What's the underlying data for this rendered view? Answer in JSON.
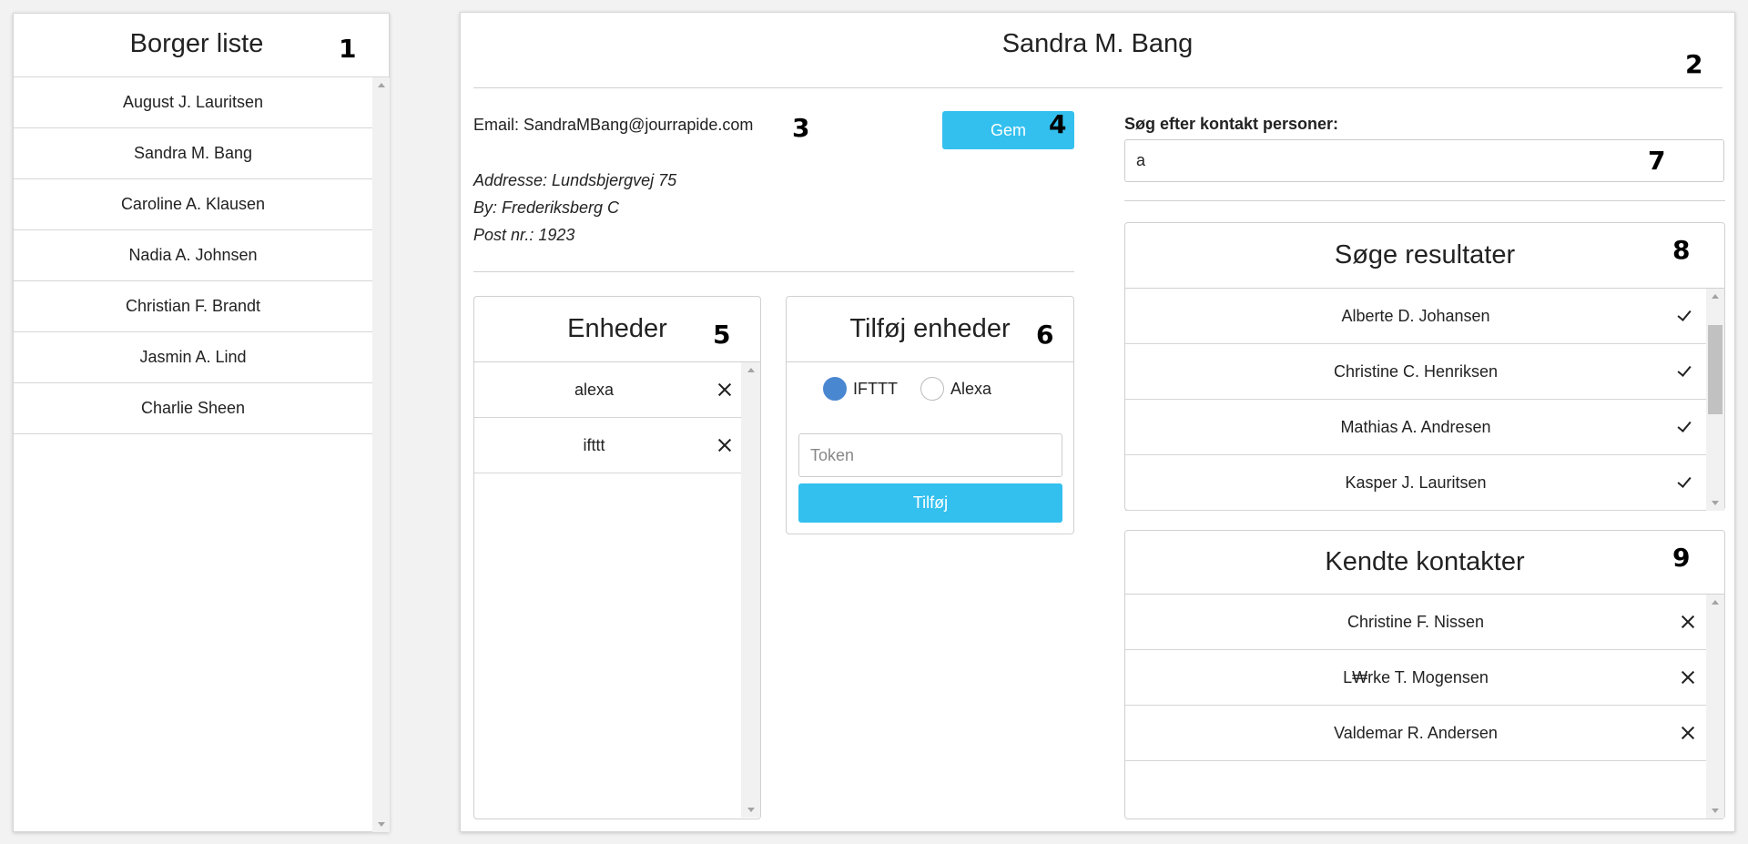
{
  "borger_liste": {
    "title": "Borger liste",
    "items": [
      {
        "name": "August J. Lauritsen"
      },
      {
        "name": "Sandra M. Bang"
      },
      {
        "name": "Caroline A. Klausen"
      },
      {
        "name": "Nadia A. Johnsen"
      },
      {
        "name": "Christian F. Brandt"
      },
      {
        "name": "Jasmin A. Lind"
      },
      {
        "name": "Charlie Sheen"
      }
    ]
  },
  "detail": {
    "name": "Sandra M. Bang",
    "email": "Email: SandraMBang@jourrapide.com",
    "save_label": "Gem",
    "address": "Addresse: Lundsbjergvej 75",
    "city": "By: Frederiksberg C",
    "postal": "Post nr.: 1923"
  },
  "enheder": {
    "title": "Enheder",
    "items": [
      {
        "name": "alexa"
      },
      {
        "name": "ifttt"
      }
    ]
  },
  "tilfoej_enheder": {
    "title": "Tilføj enheder",
    "options": [
      {
        "label": "IFTTT",
        "checked": true
      },
      {
        "label": "Alexa",
        "checked": false
      }
    ],
    "token_placeholder": "Token",
    "add_label": "Tilføj"
  },
  "search": {
    "label": "Søg efter kontakt personer:",
    "value": "a"
  },
  "soege_resultater": {
    "title": "Søge resultater",
    "items": [
      {
        "name": "Alberte D. Johansen"
      },
      {
        "name": "Christine C. Henriksen"
      },
      {
        "name": "Mathias A. Andresen"
      },
      {
        "name": "Kasper J. Lauritsen"
      }
    ]
  },
  "kendte_kontakter": {
    "title": "Kendte kontakter",
    "items": [
      {
        "name": "Christine F. Nissen"
      },
      {
        "name": "L₩rke T. Mogensen"
      },
      {
        "name": "Valdemar R. Andersen"
      }
    ]
  },
  "markers": [
    "1",
    "2",
    "3",
    "4",
    "5",
    "6",
    "7",
    "8",
    "9"
  ],
  "colors": {
    "primary_button": "#33c0ef",
    "radio_selected": "#4a87d1"
  }
}
